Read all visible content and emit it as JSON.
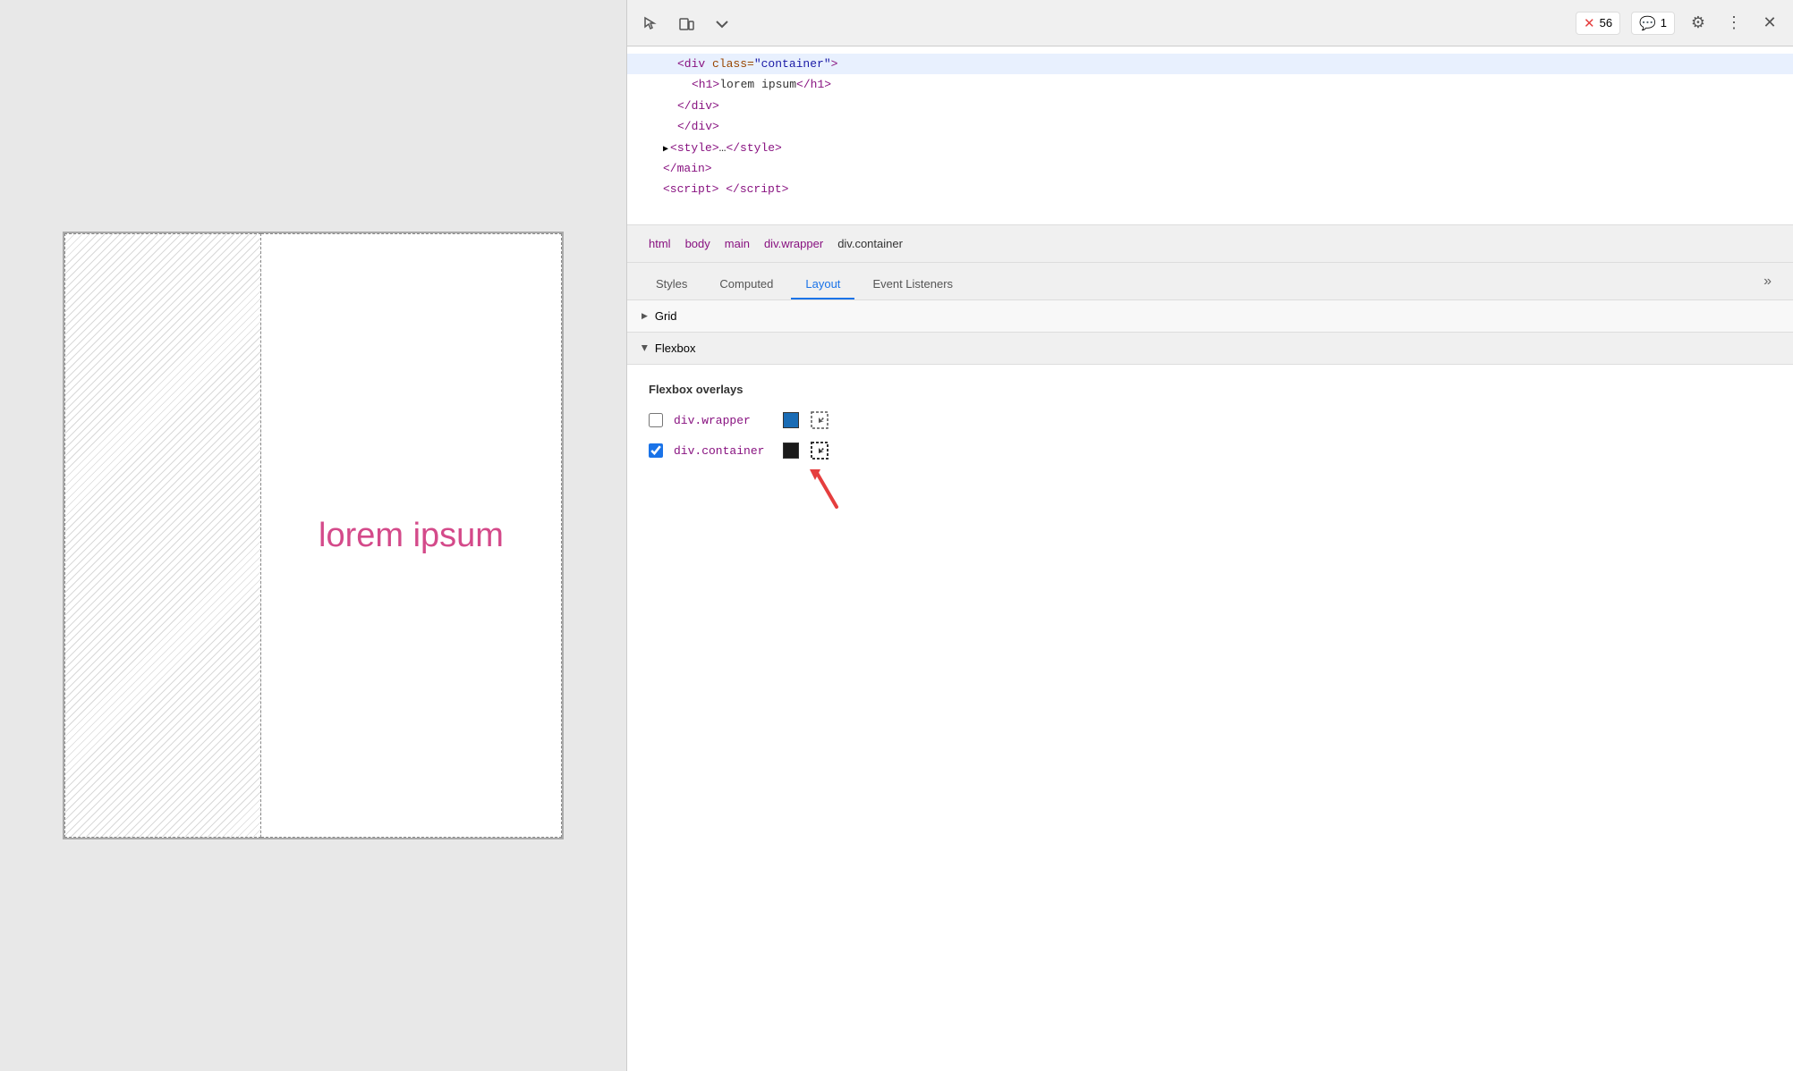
{
  "browser": {
    "lorem_text": "lorem ipsum"
  },
  "devtools": {
    "toolbar": {
      "error_count": "56",
      "message_count": "1"
    },
    "source": {
      "lines": [
        {
          "indent": 2,
          "content": "div class=\"container\"",
          "type": "open-tag",
          "highlight": true
        },
        {
          "indent": 3,
          "content": "h1>lorem ipsum</h1",
          "type": "element"
        },
        {
          "indent": 2,
          "content": "/div",
          "type": "close-tag"
        },
        {
          "indent": 1,
          "content": "/div",
          "type": "close-tag"
        },
        {
          "indent": 1,
          "content": "style>…</style",
          "type": "collapsed-tag"
        },
        {
          "indent": 0,
          "content": "/main",
          "type": "close-tag"
        },
        {
          "indent": 0,
          "content": "script> </script",
          "type": "element"
        }
      ]
    },
    "breadcrumb": {
      "items": [
        "html",
        "body",
        "main",
        "div.wrapper",
        "div.container"
      ]
    },
    "tabs": {
      "items": [
        "Styles",
        "Computed",
        "Layout",
        "Event Listeners"
      ],
      "active": "Layout"
    },
    "layout": {
      "grid_label": "Grid",
      "flexbox_label": "Flexbox",
      "flexbox_overlays_title": "Flexbox overlays",
      "items": [
        {
          "id": "wrapper",
          "label": "div.wrapper",
          "checked": false,
          "swatch_color": "#1a6cb5"
        },
        {
          "id": "container",
          "label": "div.container",
          "checked": true,
          "swatch_color": "#1a1a1a"
        }
      ]
    }
  }
}
